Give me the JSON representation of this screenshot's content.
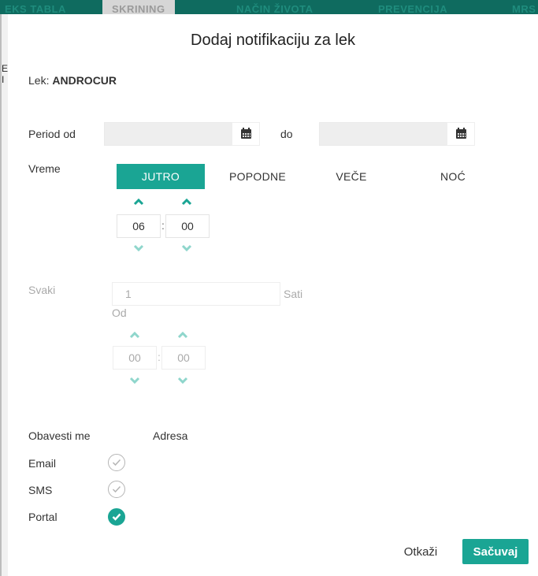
{
  "background": {
    "tabs": [
      "EKS TABLA",
      "SKRINING",
      "NAČIN ŽIVOTA",
      "PREVENCIJA",
      "MRS"
    ],
    "side_text": "E I"
  },
  "modal": {
    "title": "Dodaj notifikaciju za lek",
    "lek_label": "Lek:",
    "lek_name": "ANDROCUR",
    "period_label": "Period od",
    "period_from_value": "",
    "period_to_label": "do",
    "period_to_value": "",
    "time_label": "Vreme",
    "segments": [
      {
        "label": "JUTRO",
        "active": true
      },
      {
        "label": "POPODNE",
        "active": false
      },
      {
        "label": "VEČE",
        "active": false
      },
      {
        "label": "NOĆ",
        "active": false
      }
    ],
    "time": {
      "hours": "06",
      "separator": ":",
      "minutes": "00"
    },
    "every_label": "Svaki",
    "every_value": "1",
    "every_unit": "Sati",
    "from_label": "Od",
    "from_time": {
      "hours": "00",
      "separator": ":",
      "minutes": "00"
    },
    "notify_label": "Obavesti me",
    "address_label": "Adresa",
    "channels": [
      {
        "label": "Email",
        "checked": false
      },
      {
        "label": "SMS",
        "checked": false
      },
      {
        "label": "Portal",
        "checked": true
      }
    ],
    "cancel_label": "Otkaži",
    "save_label": "Sačuvaj",
    "accent_color": "#1aa594",
    "muted_chevron_color": "#8fd6cc"
  }
}
